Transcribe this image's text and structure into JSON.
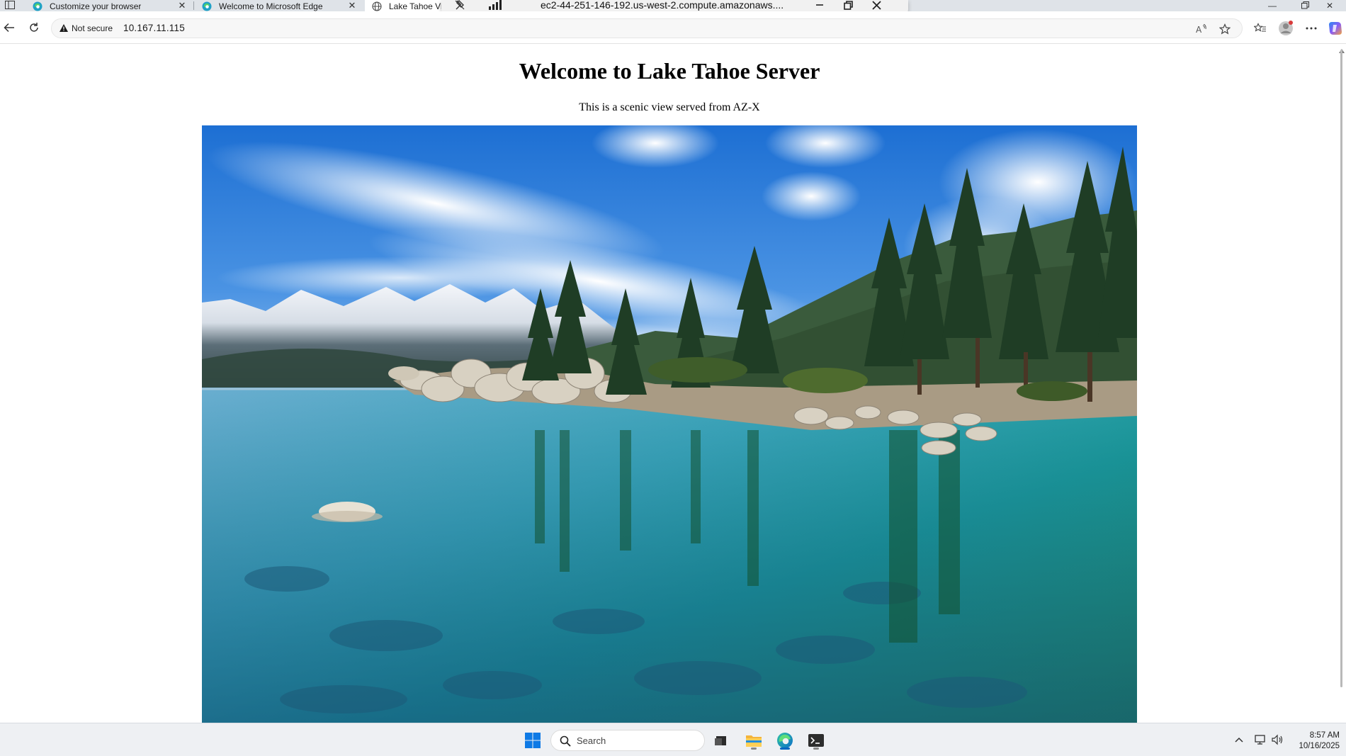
{
  "browser": {
    "tabs": [
      {
        "title": "Customize your browser"
      },
      {
        "title": "Welcome to Microsoft Edge"
      },
      {
        "title": "Lake Tahoe Vi"
      }
    ],
    "address": {
      "security_label": "Not secure",
      "url": "10.167.11.115"
    }
  },
  "remote_session": {
    "host": "ec2-44-251-146-192.us-west-2.compute.amazonaws...."
  },
  "page": {
    "heading": "Welcome to Lake Tahoe Server",
    "subtitle": "This is a scenic view served from AZ-X"
  },
  "taskbar": {
    "search_label": "Search",
    "clock_time": "8:57 AM",
    "clock_date": "10/16/2025"
  },
  "colors": {
    "accent_blue": "#0078d4",
    "tab_strip": "#dfe3e8",
    "taskbar": "#eef0f3"
  }
}
